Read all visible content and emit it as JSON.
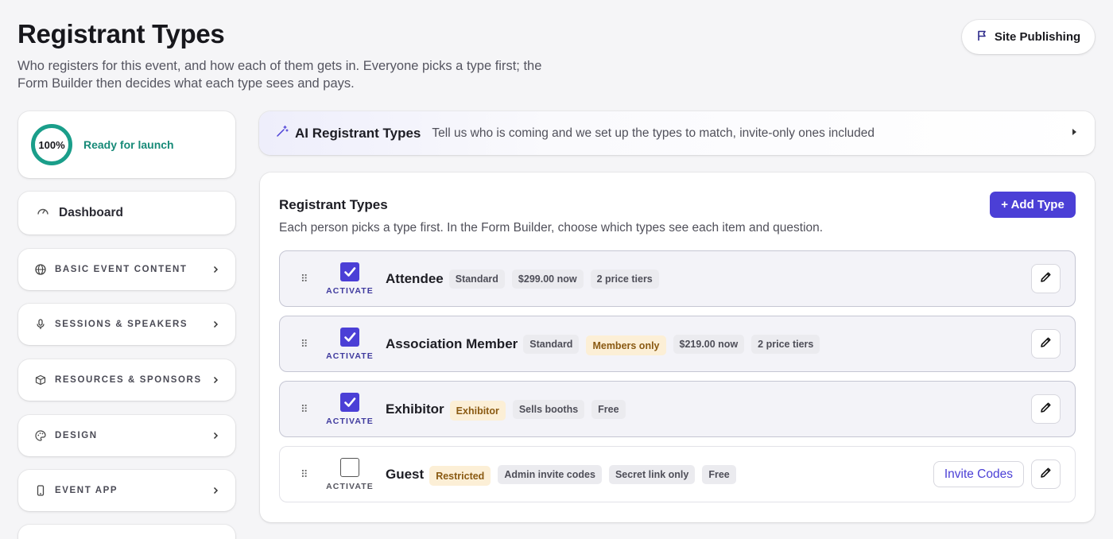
{
  "header": {
    "title": "Registrant Types",
    "subtitle": "Who registers for this event, and how each of them gets in. Everyone picks a type first; the Form Builder then decides what each type sees and pays.",
    "publish_label": "Site Publishing"
  },
  "sidebar": {
    "progress": {
      "percent_label": "100%",
      "value": 100,
      "status": "Ready for launch"
    },
    "dashboard_label": "Dashboard",
    "items": [
      {
        "label": "BASIC EVENT CONTENT",
        "icon": "globe-icon"
      },
      {
        "label": "SESSIONS & SPEAKERS",
        "icon": "microphone-icon"
      },
      {
        "label": "RESOURCES & SPONSORS",
        "icon": "box-icon"
      },
      {
        "label": "DESIGN",
        "icon": "palette-icon"
      },
      {
        "label": "EVENT APP",
        "icon": "phone-icon"
      }
    ]
  },
  "ai_bar": {
    "title": "AI Registrant Types",
    "description": "Tell us who is coming and we set up the types to match, invite-only ones included"
  },
  "panel": {
    "title": "Registrant Types",
    "description": "Each person picks a type first. In the Form Builder, choose which types see each item and question.",
    "add_label": "+ Add Type",
    "activate_label": "ACTIVATE",
    "invite_codes_label": "Invite Codes",
    "types": [
      {
        "name": "Attendee",
        "active": true,
        "badges": [
          "Standard",
          "$299.00 now",
          "2 price tiers"
        ]
      },
      {
        "name": "Association Member",
        "active": true,
        "badges": [
          "Standard",
          "Members only",
          "$219.00 now",
          "2 price tiers"
        ]
      },
      {
        "name": "Exhibitor",
        "active": true,
        "badges": [
          "Exhibitor",
          "Sells booths",
          "Free"
        ]
      },
      {
        "name": "Guest",
        "active": false,
        "badges": [
          "Restricted",
          "Admin invite codes",
          "Secret link only",
          "Free"
        ]
      }
    ]
  },
  "colors": {
    "accent": "#4b3fd6",
    "ready": "#1a9e8a",
    "amber_badge": "#fcefd6"
  }
}
